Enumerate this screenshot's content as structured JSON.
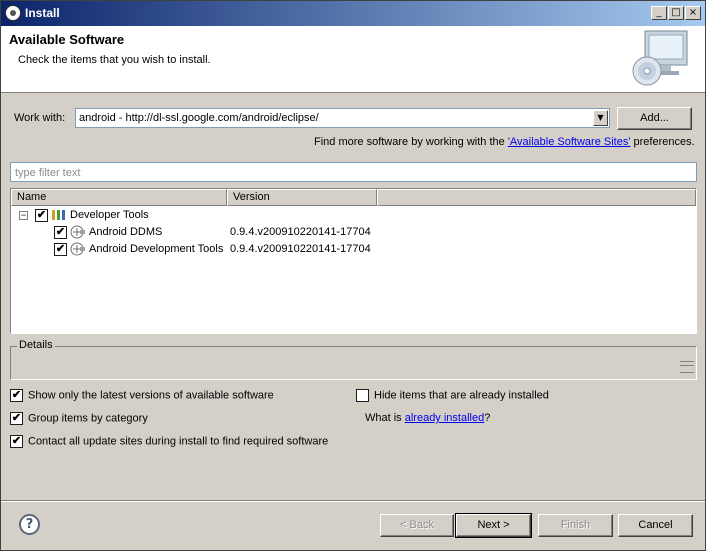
{
  "window": {
    "title": "Install",
    "controls": {
      "minimize": "_",
      "maximize": "□",
      "close": "×"
    }
  },
  "header": {
    "title": "Available Software",
    "subtitle": "Check the items that you wish to install."
  },
  "work_with": {
    "label": "Work with:",
    "value": "android - http://dl-ssl.google.com/android/eclipse/",
    "add_button": "Add..."
  },
  "sites_note": {
    "prefix": "Find more software by working with the ",
    "link": "'Available Software Sites'",
    "suffix": " preferences."
  },
  "filter": {
    "placeholder": "type filter text"
  },
  "table": {
    "columns": [
      "Name",
      "Version"
    ],
    "rows": [
      {
        "name": "Developer Tools",
        "version": "",
        "checked": true,
        "expander": "−",
        "icon": "category-icon"
      },
      {
        "name": "Android DDMS",
        "version": "0.9.4.v200910220141-17704",
        "checked": true,
        "icon": "plugin-icon"
      },
      {
        "name": "Android Development Tools",
        "version": "0.9.4.v200910220141-17704",
        "checked": true,
        "icon": "plugin-icon"
      }
    ]
  },
  "details": {
    "title": "Details"
  },
  "options": {
    "latest": {
      "label": "Show only the latest versions of available software",
      "checked": true
    },
    "hide_installed": {
      "label": "Hide items that are already installed",
      "checked": false
    },
    "group": {
      "label": "Group items by category",
      "checked": true
    },
    "contact": {
      "label": "Contact all update sites during install to find required software",
      "checked": true
    },
    "what_installed": {
      "prefix": "What is ",
      "link": "already installed",
      "suffix": "?"
    }
  },
  "buttons": {
    "back": "< Back",
    "next": "Next >",
    "finish": "Finish",
    "cancel": "Cancel"
  },
  "check_mark": "✔"
}
